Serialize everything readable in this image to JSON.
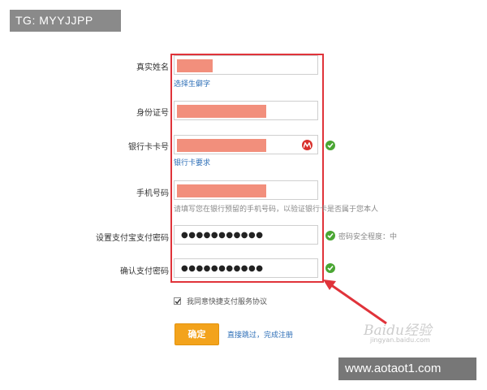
{
  "watermark": {
    "top": "TG: MYYJJPP",
    "bottom": "www.aotaot1.com"
  },
  "form": {
    "name": {
      "label": "真实姓名",
      "link": "选择生僻字"
    },
    "id_number": {
      "label": "身份证号"
    },
    "bank_card": {
      "label": "银行卡卡号",
      "link": "银行卡要求"
    },
    "phone": {
      "label": "手机号码",
      "hint": "请填写您在银行预留的手机号码，以验证银行卡是否属于您本人"
    },
    "set_password": {
      "label": "设置支付宝支付密码",
      "value": "●●●●●●●●●●●",
      "strength": "密码安全程度：中"
    },
    "confirm_password": {
      "label": "确认支付密码",
      "value": "●●●●●●●●●●●"
    }
  },
  "agreement": {
    "label": "我同意快捷支付服务协议",
    "checked": true
  },
  "buttons": {
    "confirm": "确定",
    "skip": "直接跳过，完成注册"
  },
  "brand": {
    "baidu": "Baidu经验",
    "baidu_sub": "jingyan.baidu.com"
  },
  "colors": {
    "highlight_frame": "#e0333a",
    "primary_button": "#f3a31c",
    "link": "#2e6fb7",
    "ok": "#4aa633",
    "redaction": "#f28f7c"
  },
  "icons": {
    "ok": "check-circle-icon",
    "bank": "bank-logo-icon",
    "arrow": "arrow-annotation"
  }
}
